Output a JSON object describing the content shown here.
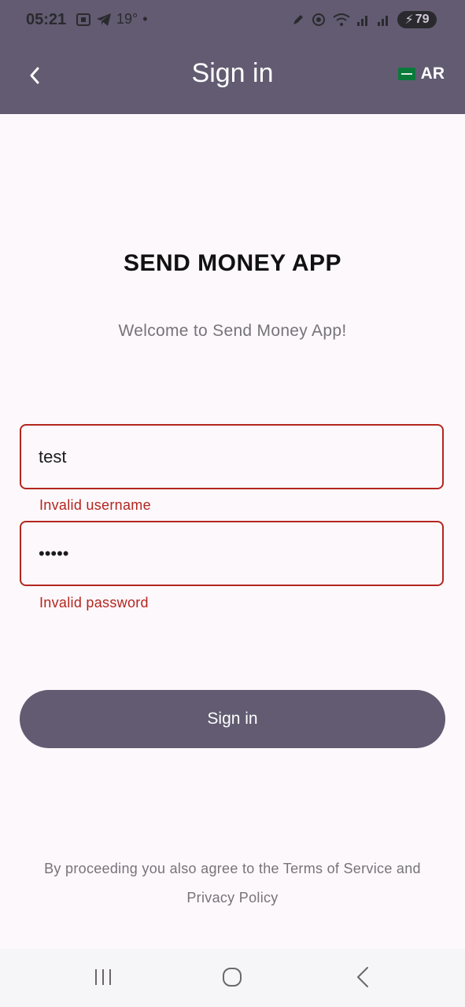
{
  "status_bar": {
    "time": "05:21",
    "temperature": "19°",
    "battery": "79"
  },
  "header": {
    "title": "Sign in",
    "language": "AR"
  },
  "main": {
    "app_title": "SEND MONEY APP",
    "welcome": "Welcome to Send Money App!",
    "username": {
      "value": "test",
      "error": "Invalid username"
    },
    "password": {
      "value": "•••••",
      "error": "Invalid password"
    },
    "signin_button": "Sign in",
    "terms_line1": "By proceeding you also agree to the Terms of Service and",
    "terms_line2": "Privacy Policy"
  },
  "colors": {
    "primary": "#625b71",
    "error": "#b3261e",
    "background": "#fdf8fc"
  },
  "icons": [
    "back-arrow-icon",
    "saudi-flag-icon",
    "recent-apps-icon",
    "home-icon",
    "nav-back-icon"
  ]
}
